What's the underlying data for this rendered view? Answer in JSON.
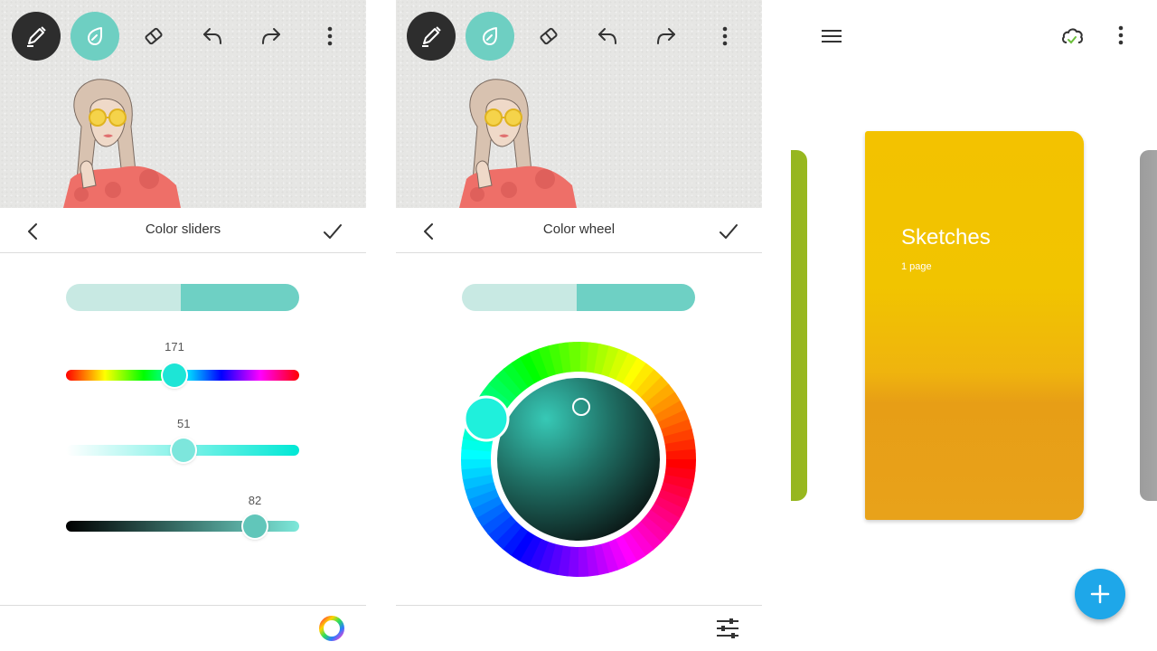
{
  "left_panel": {
    "title": "Color sliders",
    "preview": {
      "previous_color": "#c8e9e3",
      "new_color": "#6ed0c4"
    },
    "sliders": [
      {
        "name": "hue",
        "value": "171",
        "position": 0.465,
        "knob_color": "#1de5d6"
      },
      {
        "name": "saturation",
        "value": "51",
        "position": 0.505,
        "knob_color": "#7de6dc"
      },
      {
        "name": "brightness",
        "value": "82",
        "position": 0.81,
        "knob_color": "#61c6ba"
      }
    ],
    "bottom_icon": "color-wheel-icon"
  },
  "middle_panel": {
    "title": "Color wheel",
    "preview": {
      "previous_color": "#c8e9e3",
      "new_color": "#6ed0c4"
    },
    "hue_knob_color": "#1ff0dc",
    "bottom_icon": "sliders-icon"
  },
  "toolbar": {
    "icons": [
      "pen-icon",
      "ink-drop-icon",
      "eraser-icon",
      "undo-icon",
      "redo-icon",
      "more-icon"
    ],
    "active_tool_color": "#2d2d2d",
    "selected_tool_color": "#6ecfc2"
  },
  "right_panel": {
    "notebook": {
      "title": "Sketches",
      "subtitle": "1 page",
      "color": "#f1c400"
    },
    "fab_color": "#1ea7e9"
  }
}
